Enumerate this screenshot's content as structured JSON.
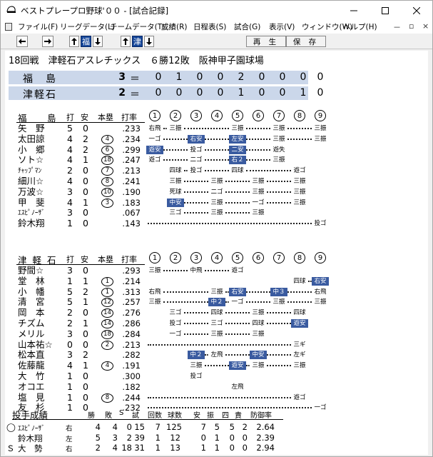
{
  "window": {
    "title": "ベストプレープロ野球'００ - [試合記録]"
  },
  "menu": [
    "ファイル(F)",
    "リーグデータ(L)",
    "チームデータ(T)",
    "成績(R)",
    "日程表(S)",
    "試合(G)",
    "表示(V)",
    "ウィンドウ(W)",
    "ヘルプ(H)"
  ],
  "toolbar": {
    "home_team": "福",
    "away_team": "津",
    "play_label": "再 生",
    "save_label": "保 存"
  },
  "game": {
    "header": "18回戦　津軽石アスレチックス　６勝12敗　阪神甲子園球場"
  },
  "linescore": [
    {
      "team": "福　島",
      "runs": "3",
      "eq": "＝",
      "innings": [
        "0",
        "1",
        "0",
        "0",
        "2",
        "0",
        "0",
        "0",
        "0"
      ]
    },
    {
      "team": "津軽石",
      "runs": "2",
      "eq": "＝",
      "innings": [
        "0",
        "0",
        "0",
        "0",
        "1",
        "0",
        "0",
        "1",
        "0"
      ]
    }
  ],
  "batting_headers": {
    "ab": "打",
    "h": "安",
    "hr": "本塁",
    "avg": "打率",
    "innings": [
      "1",
      "2",
      "3",
      "4",
      "5",
      "6",
      "7",
      "8",
      "9"
    ]
  },
  "home": {
    "team": "福　島",
    "players": [
      {
        "name": "矢　野",
        "ab": "5",
        "h": "0",
        "hr": "",
        "avg": ".233",
        "res": [
          "右飛",
          "三振",
          "",
          "",
          "三振",
          "",
          "三振",
          "",
          "三振"
        ]
      },
      {
        "name": "太田諒",
        "ab": "4",
        "h": "2",
        "hr": "4",
        "avg": ".234",
        "res": [
          "一ゴ",
          "",
          "右安",
          "",
          "左安",
          "",
          "三振",
          "",
          "三振"
        ]
      },
      {
        "name": "小　郷",
        "ab": "4",
        "h": "2",
        "hr": "6",
        "avg": ".299",
        "res": [
          "遊安",
          "",
          "投ゴ",
          "",
          "二安",
          "",
          "遊失",
          "",
          ""
        ]
      },
      {
        "name": "ソト☆",
        "ab": "4",
        "h": "1",
        "hr": "18",
        "avg": ".247",
        "res": [
          "遊ゴ",
          "",
          "二ゴ",
          "",
          "右２",
          "",
          "三振",
          "",
          ""
        ]
      },
      {
        "name": "ﾁｬｯﾌﾟﾏﾝ",
        "ab": "2",
        "h": "0",
        "hr": "7",
        "avg": ".213",
        "res": [
          "",
          "四球",
          "投ゴ",
          "",
          "四球",
          "",
          "",
          "遊ゴ",
          ""
        ]
      },
      {
        "name": "細川☆",
        "ab": "4",
        "h": "0",
        "hr": "8",
        "avg": ".241",
        "res": [
          "",
          "三振",
          "",
          "三振",
          "",
          "三振",
          "",
          "三振",
          ""
        ]
      },
      {
        "name": "万波☆",
        "ab": "3",
        "h": "0",
        "hr": "10",
        "avg": ".190",
        "res": [
          "",
          "死球",
          "",
          "二ゴ",
          "",
          "三振",
          "",
          "三振",
          ""
        ]
      },
      {
        "name": "甲　斐",
        "ab": "4",
        "h": "1",
        "hr": "3",
        "avg": ".183",
        "res": [
          "",
          "中安",
          "",
          "三振",
          "",
          "一ゴ",
          "",
          "三振",
          ""
        ]
      },
      {
        "name": "ｴｽﾋﾟﾉｰｻﾞ",
        "ab": "3",
        "h": "0",
        "hr": "",
        "avg": ".067",
        "res": [
          "",
          "三ゴ",
          "",
          "三振",
          "",
          "三振",
          "",
          "",
          ""
        ]
      },
      {
        "name": "鈴木翔",
        "ab": "1",
        "h": "0",
        "hr": "",
        "avg": ".143",
        "res": [
          "",
          "",
          "",
          "",
          "",
          "",
          "",
          "",
          "投ゴ"
        ]
      }
    ]
  },
  "away": {
    "team": "津軽石",
    "players": [
      {
        "name": "野間☆",
        "ab": "3",
        "h": "0",
        "hr": "",
        "avg": ".293",
        "res": [
          "三振",
          "",
          "中飛",
          "",
          "遊ゴ",
          "",
          "",
          "",
          ""
        ]
      },
      {
        "name": "堂　林",
        "ab": "1",
        "h": "1",
        "hr": "1",
        "avg": ".214",
        "res": [
          "",
          "",
          "",
          "",
          "",
          "",
          "",
          "四球",
          "右安"
        ]
      },
      {
        "name": "小　幡",
        "ab": "5",
        "h": "2",
        "hr": "1",
        "avg": ".313",
        "res": [
          "右飛",
          "",
          "",
          "三振",
          "右安",
          "",
          "中３",
          "",
          "右飛"
        ]
      },
      {
        "name": "清　宮",
        "ab": "5",
        "h": "1",
        "hr": "12",
        "avg": ".257",
        "res": [
          "三振",
          "",
          "",
          "中２",
          "一ゴ",
          "",
          "三振",
          "",
          "三振"
        ]
      },
      {
        "name": "岡　本",
        "ab": "2",
        "h": "0",
        "hr": "14",
        "avg": ".276",
        "res": [
          "",
          "三ゴ",
          "",
          "四球",
          "",
          "三振",
          "",
          "四球",
          ""
        ]
      },
      {
        "name": "チズム",
        "ab": "2",
        "h": "1",
        "hr": "14",
        "avg": ".286",
        "res": [
          "",
          "投ゴ",
          "",
          "三ゴ",
          "",
          "四球",
          "",
          "遊安",
          ""
        ]
      },
      {
        "name": "メリル",
        "ab": "3",
        "h": "0",
        "hr": "18",
        "avg": ".284",
        "res": [
          "",
          "一ゴ",
          "",
          "三振",
          "",
          "三振",
          "",
          "",
          ""
        ]
      },
      {
        "name": "山本祐☆",
        "ab": "0",
        "h": "0",
        "hr": "2",
        "avg": ".213",
        "res": [
          "",
          "",
          "",
          "",
          "",
          "",
          "",
          "三ギ",
          ""
        ]
      },
      {
        "name": "松本直",
        "ab": "3",
        "h": "2",
        "hr": "",
        "avg": ".282",
        "res": [
          "",
          "",
          "中２",
          "左飛",
          "",
          "中安",
          "",
          "左ギ",
          ""
        ]
      },
      {
        "name": "佐藤龍",
        "ab": "4",
        "h": "1",
        "hr": "4",
        "avg": ".191",
        "res": [
          "",
          "",
          "三振",
          "",
          "遊安",
          "三振",
          "",
          "三振",
          ""
        ]
      },
      {
        "name": "大　竹",
        "ab": "1",
        "h": "0",
        "hr": "",
        "avg": ".300",
        "res": [
          "",
          "",
          "投ゴ",
          "",
          "",
          "",
          "",
          "",
          ""
        ]
      },
      {
        "name": "オコエ",
        "ab": "1",
        "h": "0",
        "hr": "",
        "avg": ".182",
        "res": [
          "",
          "",
          "",
          "",
          "左飛",
          "",
          "",
          "",
          ""
        ]
      },
      {
        "name": "塩　見",
        "ab": "1",
        "h": "0",
        "hr": "8",
        "avg": ".244",
        "res": [
          "",
          "",
          "",
          "",
          "",
          "",
          "",
          "遊ゴ",
          ""
        ]
      },
      {
        "name": "友　杉",
        "ab": "1",
        "h": "0",
        "hr": "",
        "avg": ".232",
        "res": [
          "",
          "",
          "",
          "",
          "",
          "",
          "",
          "",
          "一ゴ"
        ]
      }
    ]
  },
  "pitching": {
    "title": "投手成績",
    "headers": [
      "勝",
      "敗",
      "S",
      "試",
      "回数",
      "球数",
      "安",
      "振",
      "四",
      "責",
      "防御率"
    ],
    "rows": [
      {
        "mark": "◯",
        "name": "ｴｽﾋﾟﾉｰｻﾞ",
        "hand": "右",
        "w": "4",
        "l": "4",
        "s": "0",
        "g": "15",
        "ip": "7",
        "np": "125",
        "h": "7",
        "so": "5",
        "bb": "5",
        "er": "2",
        "era": "2.64"
      },
      {
        "mark": "",
        "name": "鈴木翔",
        "hand": "左",
        "w": "5",
        "l": "3",
        "s": "2",
        "g": "39",
        "ip": "1",
        "np": "12",
        "h": "0",
        "so": "1",
        "bb": "0",
        "er": "0",
        "era": "2.39"
      },
      {
        "mark": "Ｓ",
        "name": "大　勢",
        "hand": "右",
        "w": "2",
        "l": "4",
        "s": "18",
        "g": "31",
        "ip": "1",
        "np": "13",
        "h": "1",
        "so": "1",
        "bb": "0",
        "er": "0",
        "era": "2.94"
      }
    ]
  }
}
